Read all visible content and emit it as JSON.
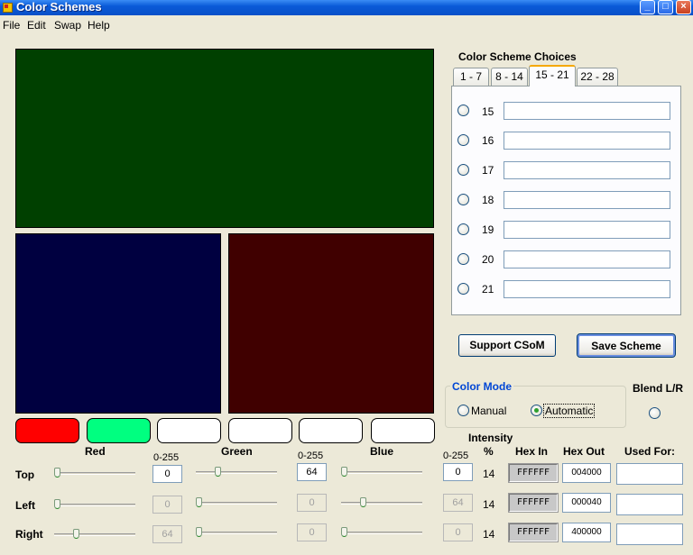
{
  "window": {
    "title": "Color Schemes",
    "buttons": {
      "minimize": "_",
      "maximize": "□",
      "close": "×"
    }
  },
  "menu": [
    "File",
    "Edit",
    "Swap",
    "Help"
  ],
  "preview": {
    "top_color": "#004000",
    "left_color": "#000040",
    "right_color": "#400000"
  },
  "swatches": [
    "#ff0000",
    "#00ff80",
    "#ffffff",
    "#ffffff",
    "#ffffff",
    "#ffffff"
  ],
  "channel_labels": {
    "red": "Red",
    "green": "Green",
    "blue": "Blue"
  },
  "range_label": "0-255",
  "intensity_label": "Intensity",
  "percent_label": "%",
  "hex_in_label": "Hex In",
  "hex_out_label": "Hex Out",
  "used_for_label": "Used For:",
  "rows": [
    {
      "label": "Top",
      "red": {
        "value": "0",
        "enabled": true
      },
      "green": {
        "value": "64",
        "enabled": true
      },
      "blue": {
        "value": "0",
        "enabled": true
      },
      "intensity": "14",
      "hex_in": "FFFFFF",
      "hex_out": "004000",
      "used_for": ""
    },
    {
      "label": "Left",
      "red": {
        "value": "0",
        "enabled": false
      },
      "green": {
        "value": "0",
        "enabled": false
      },
      "blue": {
        "value": "64",
        "enabled": false
      },
      "intensity": "14",
      "hex_in": "FFFFFF",
      "hex_out": "000040",
      "used_for": ""
    },
    {
      "label": "Right",
      "red": {
        "value": "64",
        "enabled": false
      },
      "green": {
        "value": "0",
        "enabled": false
      },
      "blue": {
        "value": "0",
        "enabled": false
      },
      "intensity": "14",
      "hex_in": "FFFFFF",
      "hex_out": "400000",
      "used_for": ""
    }
  ],
  "choices": {
    "title": "Color Scheme Choices",
    "tabs": [
      "1 - 7",
      "8 - 14",
      "15 - 21",
      "22 - 28"
    ],
    "active_tab": "15 - 21",
    "items": [
      {
        "number": "15",
        "value": ""
      },
      {
        "number": "16",
        "value": ""
      },
      {
        "number": "17",
        "value": ""
      },
      {
        "number": "18",
        "value": ""
      },
      {
        "number": "19",
        "value": ""
      },
      {
        "number": "20",
        "value": ""
      },
      {
        "number": "21",
        "value": ""
      }
    ]
  },
  "buttons": {
    "support": "Support CSoM",
    "save": "Save Scheme"
  },
  "color_mode": {
    "title": "Color Mode",
    "manual": "Manual",
    "automatic": "Automatic",
    "selected": "Automatic"
  },
  "blend_label": "Blend L/R"
}
